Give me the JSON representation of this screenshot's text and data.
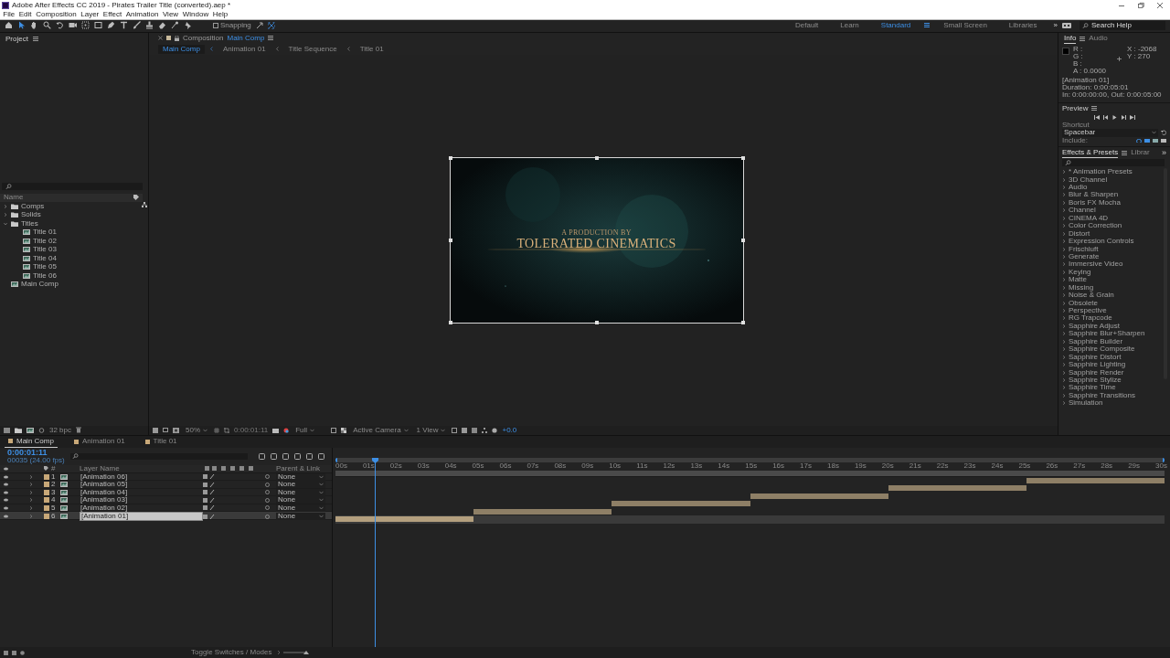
{
  "window": {
    "title": "Adobe After Effects CC 2019 - Pirates Trailer Title (converted).aep *"
  },
  "menu": [
    "File",
    "Edit",
    "Composition",
    "Layer",
    "Effect",
    "Animation",
    "View",
    "Window",
    "Help"
  ],
  "toolbar": {
    "snapping": {
      "label": "Snapping",
      "checked": false
    },
    "workspaces": [
      {
        "label": "Default",
        "selected": false
      },
      {
        "label": "Learn",
        "selected": false
      },
      {
        "label": "Standard",
        "selected": true
      },
      {
        "label": "Small Screen",
        "selected": false
      },
      {
        "label": "Libraries",
        "selected": false
      }
    ],
    "overflow": "»",
    "search": {
      "placeholder": "Search Help"
    }
  },
  "project": {
    "title": "Project",
    "column": "Name",
    "depth": "32 bpc",
    "items": [
      {
        "kind": "folder",
        "label": "Comps",
        "expanded": false
      },
      {
        "kind": "folder",
        "label": "Solids",
        "expanded": false
      },
      {
        "kind": "folder",
        "label": "Titles",
        "expanded": true,
        "children": [
          {
            "kind": "comp",
            "label": "Title 01"
          },
          {
            "kind": "comp",
            "label": "Title 02"
          },
          {
            "kind": "comp",
            "label": "Title 03"
          },
          {
            "kind": "comp",
            "label": "Title 04"
          },
          {
            "kind": "comp",
            "label": "Title 05"
          },
          {
            "kind": "comp",
            "label": "Title 06"
          }
        ]
      },
      {
        "kind": "comp",
        "label": "Main Comp"
      }
    ]
  },
  "composition": {
    "label": "Composition",
    "name": "Main Comp",
    "breadcrumbs": [
      {
        "label": "Main Comp",
        "selected": true
      },
      {
        "label": "Animation 01",
        "selected": false
      },
      {
        "label": "Title Sequence",
        "selected": false
      },
      {
        "label": "Title 01",
        "selected": false
      }
    ],
    "frame": {
      "kicker": "A PRODUCTION BY",
      "title": "TOLERATED CINEMATICS"
    },
    "controls": {
      "zoom": "50%",
      "time": "0:00:01:11",
      "resolution": "Full",
      "camera": "Active Camera",
      "views": "1 View",
      "exposure": "+0.0"
    }
  },
  "info": {
    "tabs": [
      {
        "label": "Info",
        "selected": true
      },
      {
        "label": "Audio",
        "selected": false
      }
    ],
    "channels": [
      "R :",
      "G :",
      "B :",
      "A : 0.0000"
    ],
    "coords": [
      "X : -2068",
      "Y : 270"
    ],
    "details": [
      "[Animation 01]",
      "Duration: 0:00:05:01",
      "In: 0:00:00:00, Out: 0:00:05:00"
    ]
  },
  "preview": {
    "title": "Preview",
    "shortcut_label": "Shortcut",
    "shortcut": "Spacebar",
    "include_label": "Include:"
  },
  "effects": {
    "tabs": [
      {
        "label": "Effects & Presets",
        "selected": true
      },
      {
        "label": "Librar",
        "selected": false
      }
    ],
    "overflow": "»",
    "categories": [
      "* Animation Presets",
      "3D Channel",
      "Audio",
      "Blur & Sharpen",
      "Boris FX Mocha",
      "Channel",
      "CINEMA 4D",
      "Color Correction",
      "Distort",
      "Expression Controls",
      "Frischluft",
      "Generate",
      "Immersive Video",
      "Keying",
      "Matte",
      "Missing",
      "Noise & Grain",
      "Obsolete",
      "Perspective",
      "RG Trapcode",
      "Sapphire Adjust",
      "Sapphire Blur+Sharpen",
      "Sapphire Builder",
      "Sapphire Composite",
      "Sapphire Distort",
      "Sapphire Lighting",
      "Sapphire Render",
      "Sapphire Stylize",
      "Sapphire Time",
      "Sapphire Transitions",
      "Simulation"
    ]
  },
  "timeline": {
    "tabs": [
      {
        "label": "Main Comp",
        "selected": true
      },
      {
        "label": "Animation 01",
        "selected": false
      },
      {
        "label": "Title 01",
        "selected": false
      }
    ],
    "time": "0:00:01:11",
    "frame_info": "00035 (24.00 fps)",
    "columns": {
      "number": "#",
      "name": "Layer Name",
      "parent": "Parent & Link"
    },
    "layers": [
      {
        "number": "1",
        "name": "[Animation 06]",
        "parent": "None",
        "selected": false
      },
      {
        "number": "2",
        "name": "[Animation 05]",
        "parent": "None",
        "selected": false
      },
      {
        "number": "3",
        "name": "[Animation 04]",
        "parent": "None",
        "selected": false
      },
      {
        "number": "4",
        "name": "[Animation 03]",
        "parent": "None",
        "selected": false
      },
      {
        "number": "5",
        "name": "[Animation 02]",
        "parent": "None",
        "selected": false
      },
      {
        "number": "6",
        "name": "[Animation 01]",
        "parent": "None",
        "selected": true
      }
    ],
    "ruler_labels": [
      "00s",
      "01s",
      "02s",
      "03s",
      "04s",
      "05s",
      "06s",
      "07s",
      "08s",
      "09s",
      "10s",
      "11s",
      "12s",
      "13s",
      "14s",
      "15s",
      "16s",
      "17s",
      "18s",
      "19s",
      "20s",
      "21s",
      "22s",
      "23s",
      "24s",
      "25s",
      "26s",
      "27s",
      "28s",
      "29s",
      "30s"
    ]
  },
  "status": {
    "toggle": "Toggle Switches / Modes"
  }
}
